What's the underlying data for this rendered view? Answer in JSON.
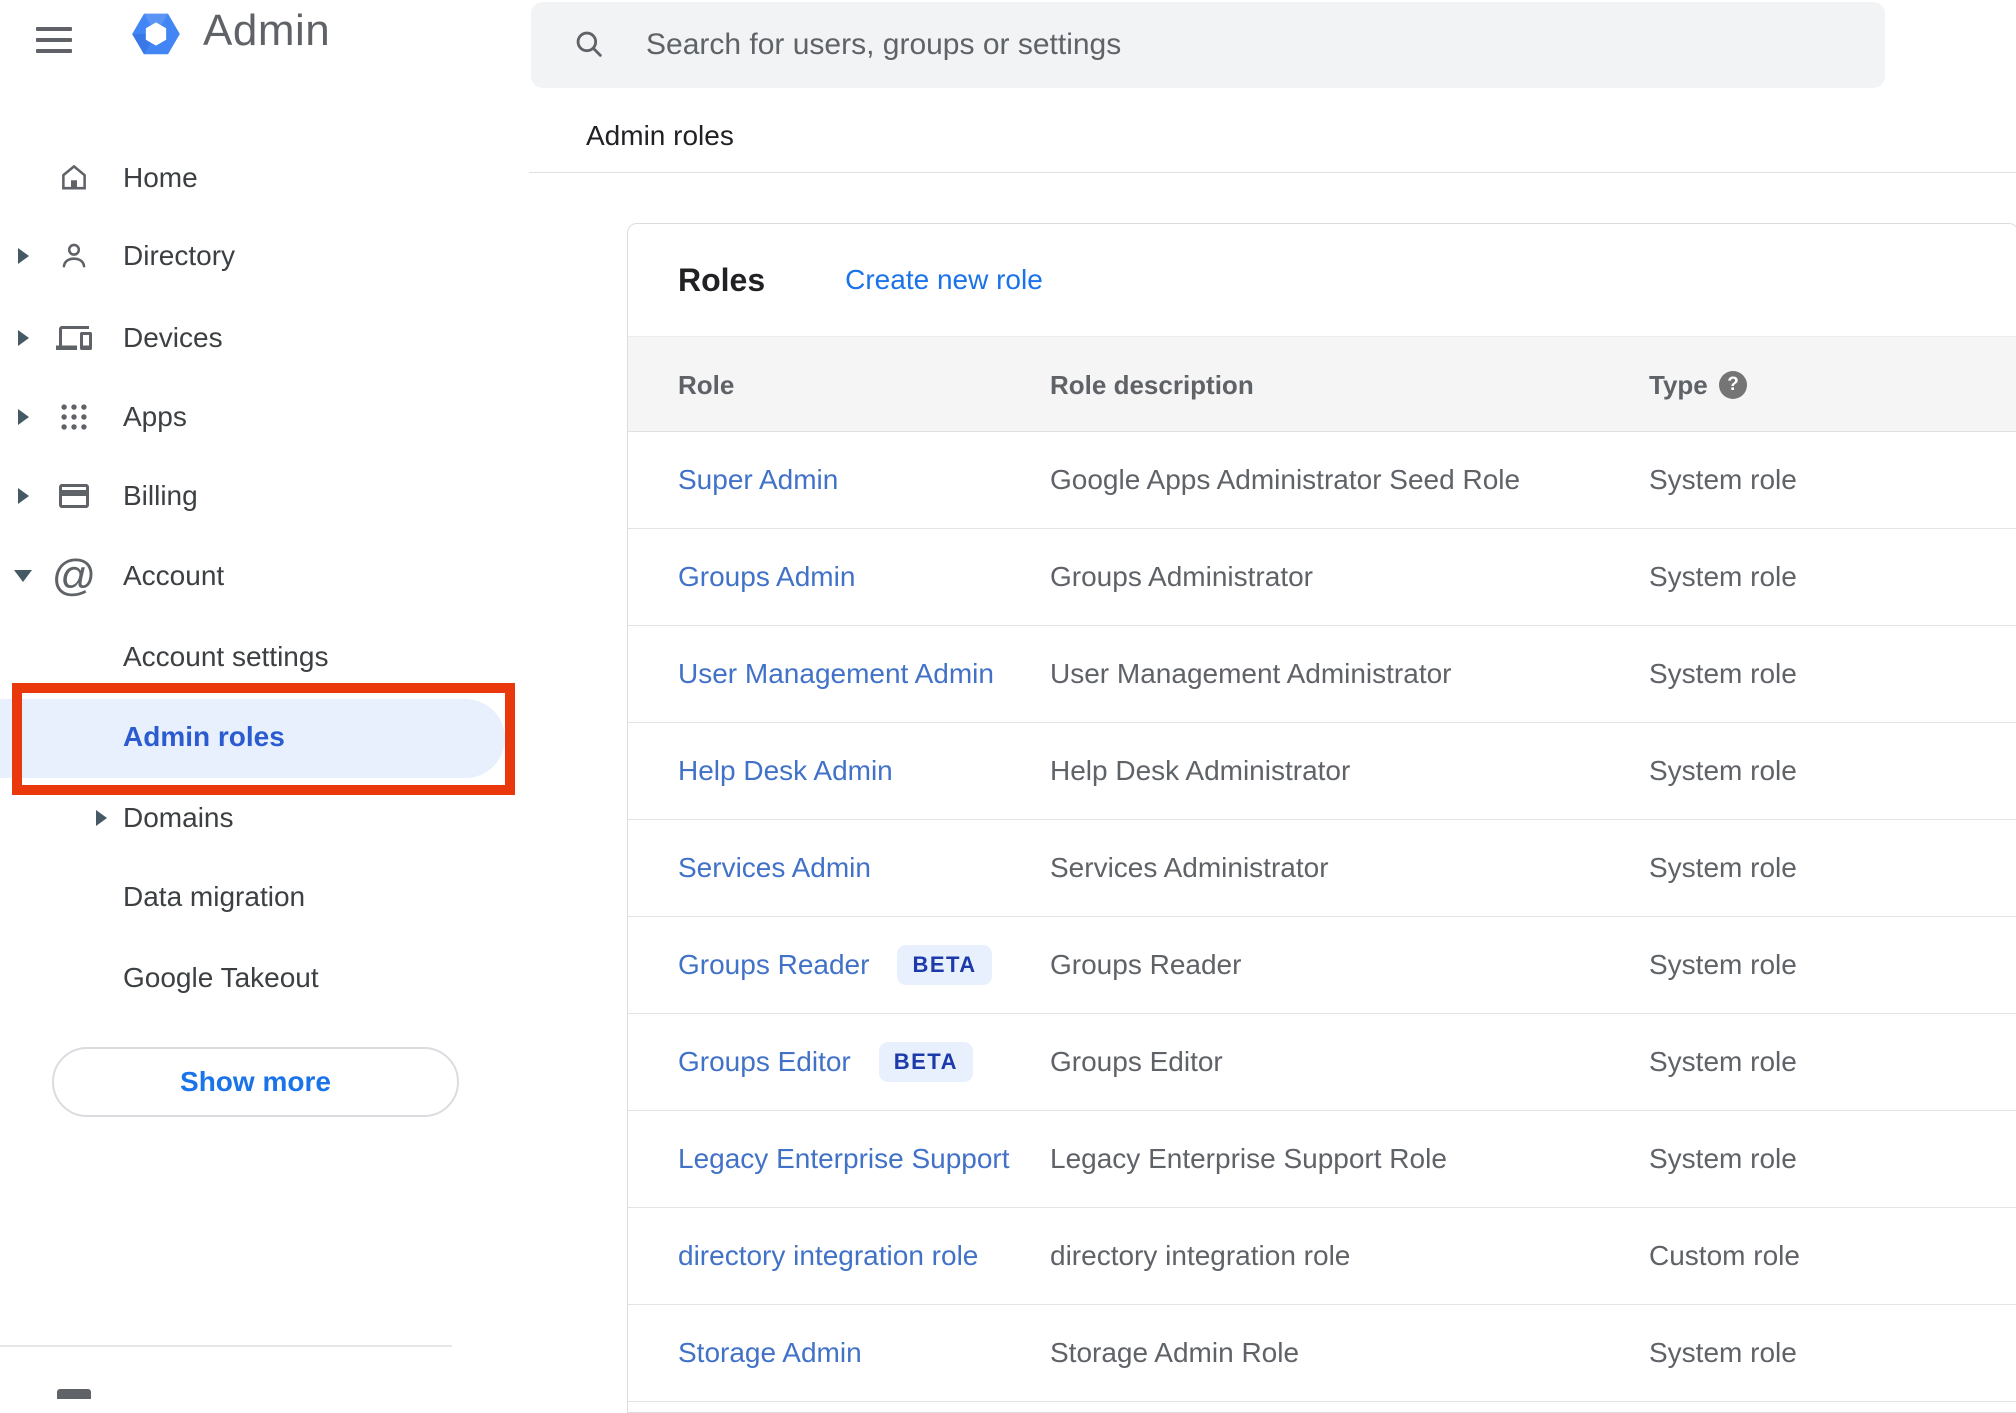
{
  "app": {
    "title": "Admin"
  },
  "search": {
    "placeholder": "Search for users, groups or settings",
    "icon": "search-icon"
  },
  "breadcrumb": "Admin roles",
  "sidebar": {
    "items": [
      {
        "label": "Home",
        "icon": "home-icon",
        "expandable": false,
        "sub": false,
        "selected": false
      },
      {
        "label": "Directory",
        "icon": "person-icon",
        "expandable": true,
        "sub": false,
        "selected": false
      },
      {
        "label": "Devices",
        "icon": "devices-icon",
        "expandable": true,
        "sub": false,
        "selected": false
      },
      {
        "label": "Apps",
        "icon": "apps-icon",
        "expandable": true,
        "sub": false,
        "selected": false
      },
      {
        "label": "Billing",
        "icon": "card-icon",
        "expandable": true,
        "sub": false,
        "selected": false
      },
      {
        "label": "Account",
        "icon": "at-icon",
        "expandable": true,
        "expanded": true,
        "sub": false,
        "selected": false
      },
      {
        "label": "Account settings",
        "icon": null,
        "expandable": false,
        "sub": true,
        "selected": false
      },
      {
        "label": "Admin roles",
        "icon": null,
        "expandable": false,
        "sub": true,
        "selected": true
      },
      {
        "label": "Domains",
        "icon": null,
        "expandable": true,
        "sub": true,
        "selected": false
      },
      {
        "label": "Data migration",
        "icon": null,
        "expandable": false,
        "sub": true,
        "selected": false
      },
      {
        "label": "Google Takeout",
        "icon": null,
        "expandable": false,
        "sub": true,
        "selected": false
      }
    ],
    "show_more_label": "Show more"
  },
  "main": {
    "card_title": "Roles",
    "create_link": "Create new role",
    "table": {
      "columns": [
        "Role",
        "Role description",
        "Type"
      ],
      "help_icon": "help-icon",
      "rows": [
        {
          "role": "Super Admin",
          "badge": "",
          "description": "Google Apps Administrator Seed Role",
          "type": "System role"
        },
        {
          "role": "Groups Admin",
          "badge": "",
          "description": "Groups Administrator",
          "type": "System role"
        },
        {
          "role": "User Management Admin",
          "badge": "",
          "description": "User Management Administrator",
          "type": "System role"
        },
        {
          "role": "Help Desk Admin",
          "badge": "",
          "description": "Help Desk Administrator",
          "type": "System role"
        },
        {
          "role": "Services Admin",
          "badge": "",
          "description": "Services Administrator",
          "type": "System role"
        },
        {
          "role": "Groups Reader",
          "badge": "BETA",
          "description": "Groups Reader",
          "type": "System role"
        },
        {
          "role": "Groups Editor",
          "badge": "BETA",
          "description": "Groups Editor",
          "type": "System role"
        },
        {
          "role": "Legacy Enterprise Support",
          "badge": "",
          "description": "Legacy Enterprise Support Role",
          "type": "System role"
        },
        {
          "role": "directory integration role",
          "badge": "",
          "description": "directory integration role",
          "type": "Custom role"
        },
        {
          "role": "Storage Admin",
          "badge": "",
          "description": "Storage Admin Role",
          "type": "System role"
        }
      ]
    }
  },
  "annotation": {
    "shape": "red-highlight-rectangle",
    "target": "Admin roles",
    "color": "#e8380c"
  },
  "colors": {
    "accent_blue": "#1a73e8",
    "selected_blue": "#2a5cd0",
    "link_blue": "#4272c8",
    "beta_text": "#1c3aa9",
    "beta_bg": "#e8f0fe",
    "pill_bg": "#e8f0fe",
    "thead_bg": "#f5f5f5",
    "searchbar_bg": "#f1f3f4",
    "text_gray": "#5f6368"
  }
}
